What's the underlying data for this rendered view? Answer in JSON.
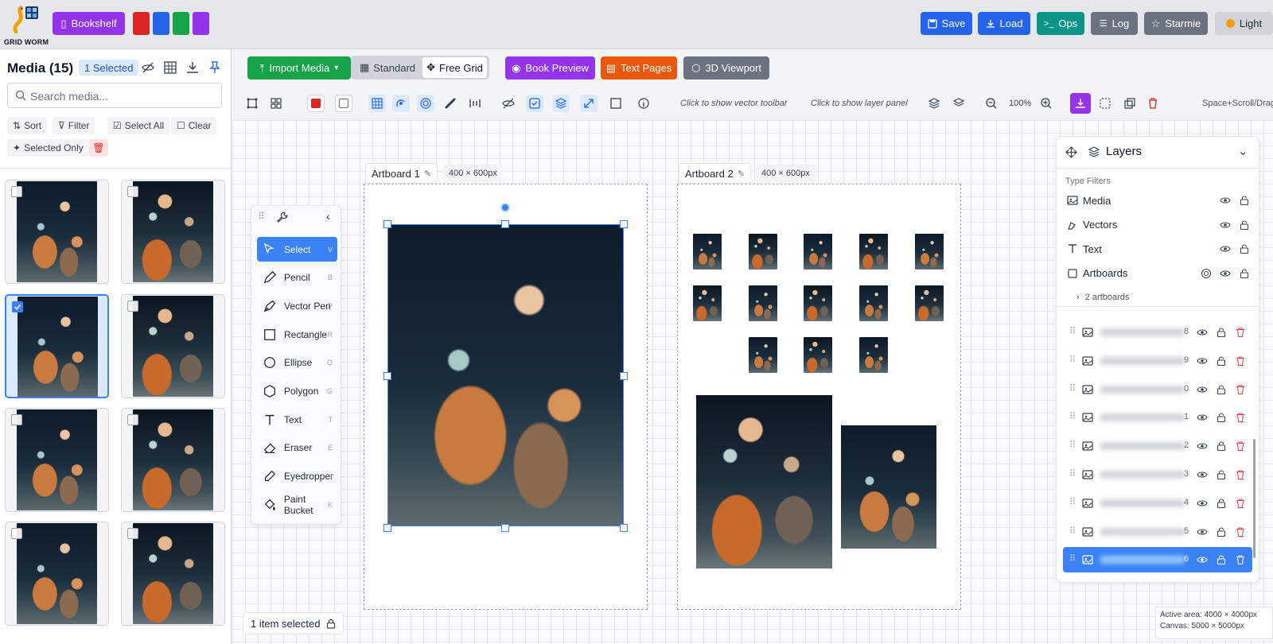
{
  "header": {
    "logo_text": "GRID WORM",
    "bookshelf_label": "Bookshelf",
    "swatches": [
      "#dc2626",
      "#2563eb",
      "#16a34a",
      "#9333ea"
    ],
    "save_label": "Save",
    "load_label": "Load",
    "ops_label": "Ops",
    "log_label": "Log",
    "starmie_label": "Starmie",
    "theme_label": "Light",
    "colors": {
      "purple": "#9333ea",
      "blue": "#2563eb",
      "teal": "#0d9488",
      "gray": "#6b7280"
    }
  },
  "media_panel": {
    "title": "Media (15)",
    "selected_badge": "1 Selected",
    "search_placeholder": "Search media...",
    "sort_label": "Sort",
    "filter_label": "Filter",
    "select_all_label": "Select All",
    "clear_label": "Clear",
    "selected_only_label": "Selected Only",
    "thumbnails": [
      {
        "selected": false
      },
      {
        "selected": false
      },
      {
        "selected": true
      },
      {
        "selected": false
      },
      {
        "selected": false
      },
      {
        "selected": false
      },
      {
        "selected": false
      },
      {
        "selected": false
      }
    ]
  },
  "toolbar": {
    "import_label": "Import Media",
    "standard_label": "Standard",
    "free_grid_label": "Free Grid",
    "book_preview_label": "Book Preview",
    "text_pages_label": "Text Pages",
    "viewport_label": "3D Viewport",
    "vector_hint": "Click to show vector toolbar",
    "layer_hint": "Click to show layer panel",
    "zoom": "100%",
    "nav_hint": "Space+Scroll/Drag"
  },
  "artboards": [
    {
      "name": "Artboard 1",
      "size": "400 × 600px"
    },
    {
      "name": "Artboard 2",
      "size": "400 × 600px"
    }
  ],
  "tools": [
    {
      "name": "Select",
      "key": "V",
      "icon": "cursor-icon",
      "active": true
    },
    {
      "name": "Pencil",
      "key": "B",
      "icon": "pencil-icon",
      "active": false
    },
    {
      "name": "Vector Pen",
      "key": "P",
      "icon": "pen-icon",
      "active": false
    },
    {
      "name": "Rectangle",
      "key": "R",
      "icon": "rectangle-icon",
      "active": false
    },
    {
      "name": "Ellipse",
      "key": "O",
      "icon": "ellipse-icon",
      "active": false
    },
    {
      "name": "Polygon",
      "key": "G",
      "icon": "polygon-icon",
      "active": false
    },
    {
      "name": "Text",
      "key": "T",
      "icon": "text-icon",
      "active": false
    },
    {
      "name": "Eraser",
      "key": "E",
      "icon": "eraser-icon",
      "active": false
    },
    {
      "name": "Eyedropper",
      "key": "I",
      "icon": "eyedropper-icon",
      "active": false
    },
    {
      "name": "Paint Bucket",
      "key": "K",
      "icon": "bucket-icon",
      "active": false
    }
  ],
  "layers_panel": {
    "title": "Layers",
    "type_filters_label": "Type Filters",
    "types": [
      {
        "label": "Media",
        "icon": "image-icon"
      },
      {
        "label": "Vectors",
        "icon": "vector-icon"
      },
      {
        "label": "Text",
        "icon": "text-icon"
      },
      {
        "label": "Artboards",
        "icon": "artboard-icon"
      }
    ],
    "artboards_sub": "2 artboards",
    "rows": [
      {
        "num": "8",
        "selected": false
      },
      {
        "num": "9",
        "selected": false
      },
      {
        "num": "0",
        "selected": false
      },
      {
        "num": "1",
        "selected": false
      },
      {
        "num": "2",
        "selected": false
      },
      {
        "num": "3",
        "selected": false
      },
      {
        "num": "4",
        "selected": false
      },
      {
        "num": "5",
        "selected": false
      },
      {
        "num": "6",
        "selected": true
      }
    ]
  },
  "status": {
    "selection": "1 item selected",
    "active_area": "Active area: 4000 × 4000px",
    "canvas_size": "Canvas: 5000 × 5000px"
  }
}
